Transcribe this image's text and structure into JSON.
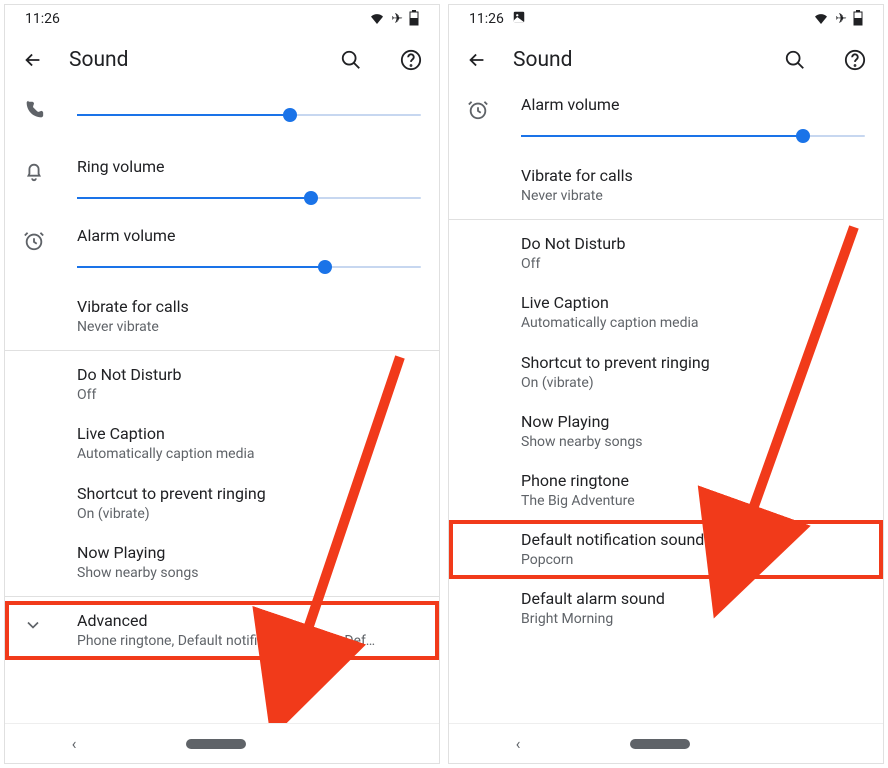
{
  "status": {
    "time": "11:26"
  },
  "header": {
    "title": "Sound"
  },
  "left": {
    "sliders": {
      "call": {
        "label": "",
        "value": 62
      },
      "ring": {
        "label": "Ring volume",
        "value": 68
      },
      "alarm": {
        "label": "Alarm volume",
        "value": 72
      }
    },
    "vibrate": {
      "label": "Vibrate for calls",
      "sub": "Never vibrate"
    },
    "dnd": {
      "label": "Do Not Disturb",
      "sub": "Off"
    },
    "caption": {
      "label": "Live Caption",
      "sub": "Automatically caption media"
    },
    "shortcut": {
      "label": "Shortcut to prevent ringing",
      "sub": "On (vibrate)"
    },
    "nowplay": {
      "label": "Now Playing",
      "sub": "Show nearby songs"
    },
    "advanced": {
      "label": "Advanced",
      "sub": "Phone ringtone, Default notification sound, Def…"
    }
  },
  "right": {
    "alarm": {
      "label": "Alarm volume",
      "value": 82
    },
    "vibrate": {
      "label": "Vibrate for calls",
      "sub": "Never vibrate"
    },
    "dnd": {
      "label": "Do Not Disturb",
      "sub": "Off"
    },
    "caption": {
      "label": "Live Caption",
      "sub": "Automatically caption media"
    },
    "shortcut": {
      "label": "Shortcut to prevent ringing",
      "sub": "On (vibrate)"
    },
    "nowplay": {
      "label": "Now Playing",
      "sub": "Show nearby songs"
    },
    "ringtone": {
      "label": "Phone ringtone",
      "sub": "The Big Adventure"
    },
    "notif": {
      "label": "Default notification sound",
      "sub": "Popcorn"
    },
    "alarmsnd": {
      "label": "Default alarm sound",
      "sub": "Bright Morning"
    }
  }
}
